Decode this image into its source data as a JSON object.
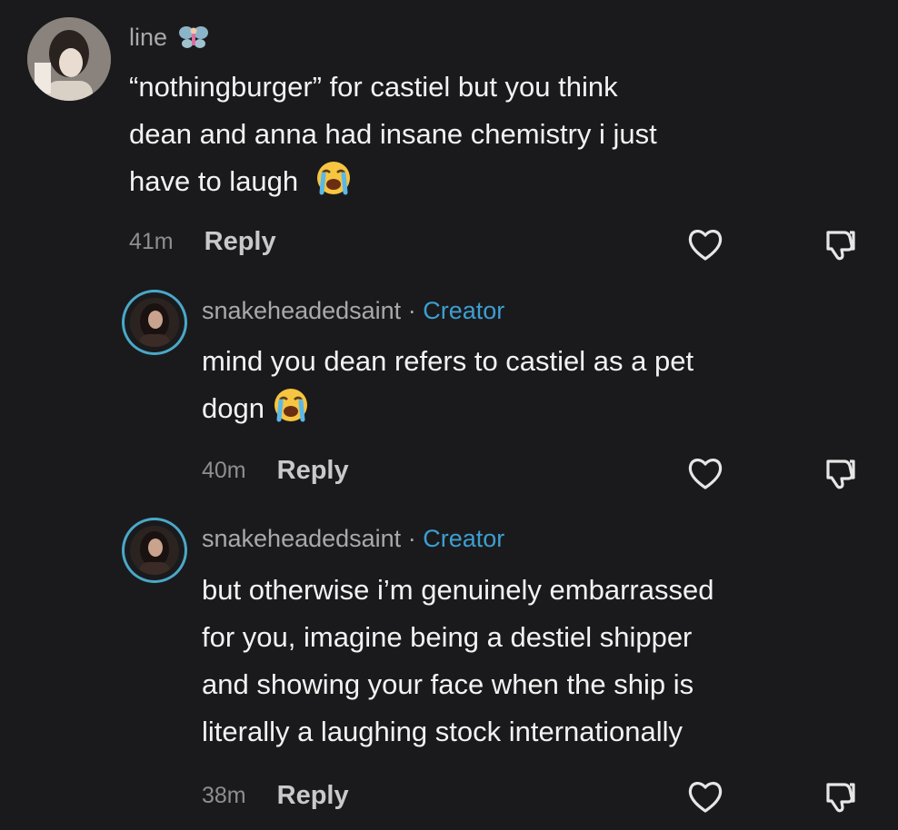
{
  "comments": [
    {
      "username": "line",
      "username_emoji": "fairy-emoji",
      "text_lines": [
        "“nothingburger” for castiel but you think",
        "dean and anna had insane chemistry i just",
        "have to laugh"
      ],
      "trailing_emoji": "loudly-crying-face-emoji",
      "time": "41m",
      "reply_label": "Reply"
    },
    {
      "username": "snakeheadedsaint",
      "separator": "·",
      "badge": "Creator",
      "text_lines": [
        "mind you dean refers to castiel as a pet",
        "dogn"
      ],
      "trailing_emoji": "loudly-crying-face-emoji",
      "time": "40m",
      "reply_label": "Reply"
    },
    {
      "username": "snakeheadedsaint",
      "separator": "·",
      "badge": "Creator",
      "text_lines": [
        "but otherwise i’m genuinely embarrassed",
        "for you, imagine being a destiel shipper",
        "and showing your face when the ship is",
        "literally a laughing stock internationally"
      ],
      "time": "38m",
      "reply_label": "Reply"
    }
  ],
  "colors": {
    "background": "#1a1a1c",
    "creator_badge": "#3d9ed1",
    "story_ring": "#4aa8c8"
  }
}
